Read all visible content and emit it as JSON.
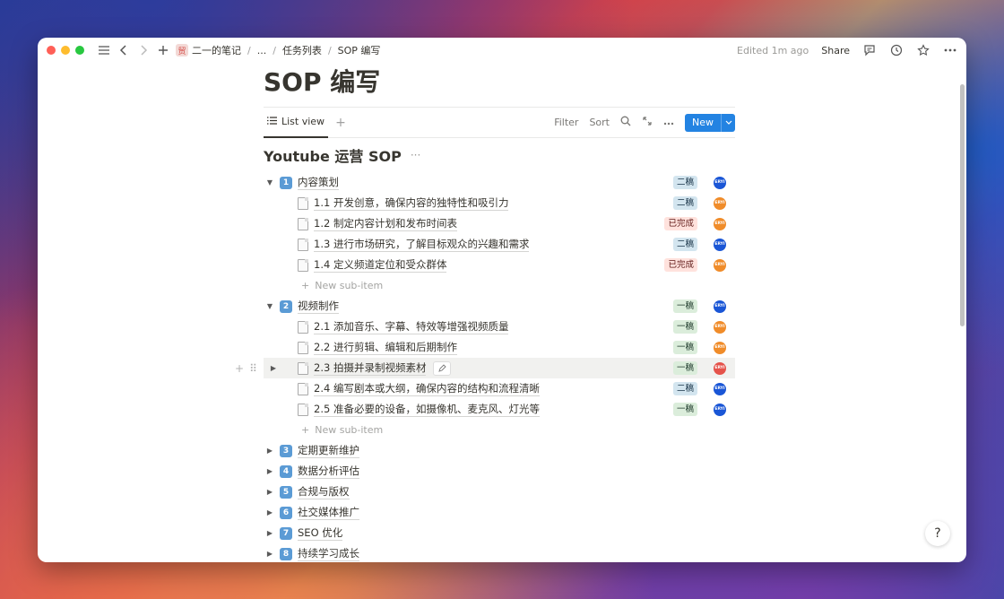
{
  "breadcrumb": {
    "workspace_icon": "贸",
    "items": [
      "二一的笔记",
      "...",
      "任务列表",
      "SOP 编写"
    ]
  },
  "header": {
    "edited": "Edited 1m ago",
    "share": "Share"
  },
  "page": {
    "title": "SOP 编写"
  },
  "viewbar": {
    "tab": "List view",
    "filter": "Filter",
    "sort": "Sort",
    "new": "New"
  },
  "database": {
    "title": "Youtube 运营 SOP"
  },
  "groups": [
    {
      "num": "1",
      "label": "内容策划",
      "badge": "二稿",
      "badge_type": "b2",
      "avatar": "blue",
      "expanded": true,
      "items": [
        {
          "label": "1.1 开发创意，确保内容的独特性和吸引力",
          "badge": "二稿",
          "badge_type": "b2",
          "avatar": "orange"
        },
        {
          "label": "1.2 制定内容计划和发布时间表",
          "badge": "已完成",
          "badge_type": "done",
          "avatar": "orange"
        },
        {
          "label": "1.3 进行市场研究，了解目标观众的兴趣和需求",
          "badge": "二稿",
          "badge_type": "b2",
          "avatar": "blue"
        },
        {
          "label": "1.4 定义频道定位和受众群体",
          "badge": "已完成",
          "badge_type": "done",
          "avatar": "orange"
        }
      ]
    },
    {
      "num": "2",
      "label": "视频制作",
      "badge": "一稿",
      "badge_type": "b1",
      "avatar": "blue",
      "expanded": true,
      "items": [
        {
          "label": "2.1 添加音乐、字幕、特效等增强视频质量",
          "badge": "一稿",
          "badge_type": "b1",
          "avatar": "orange"
        },
        {
          "label": "2.2 进行剪辑、编辑和后期制作",
          "badge": "一稿",
          "badge_type": "b1",
          "avatar": "orange"
        },
        {
          "label": "2.3 拍摄并录制视频素材",
          "badge": "一稿",
          "badge_type": "b1",
          "avatar": "red",
          "hover": true
        },
        {
          "label": "2.4 编写剧本或大纲，确保内容的结构和流程清晰",
          "badge": "二稿",
          "badge_type": "b2",
          "avatar": "blue"
        },
        {
          "label": "2.5 准备必要的设备，如摄像机、麦克风、灯光等",
          "badge": "一稿",
          "badge_type": "b1",
          "avatar": "blue"
        }
      ]
    },
    {
      "num": "3",
      "label": "定期更新维护"
    },
    {
      "num": "4",
      "label": "数据分析评估"
    },
    {
      "num": "5",
      "label": "合规与版权"
    },
    {
      "num": "6",
      "label": "社交媒体推广"
    },
    {
      "num": "7",
      "label": "SEO 优化"
    },
    {
      "num": "8",
      "label": "持续学习成长"
    }
  ],
  "new_sub_item": "New sub-item",
  "avatar_text": "ERYI",
  "help": "?",
  "colors": {
    "accent": "#2383e2",
    "badge_second": "#d3e5ef",
    "badge_first": "#dbeddb",
    "badge_done": "#ffe2dd"
  }
}
